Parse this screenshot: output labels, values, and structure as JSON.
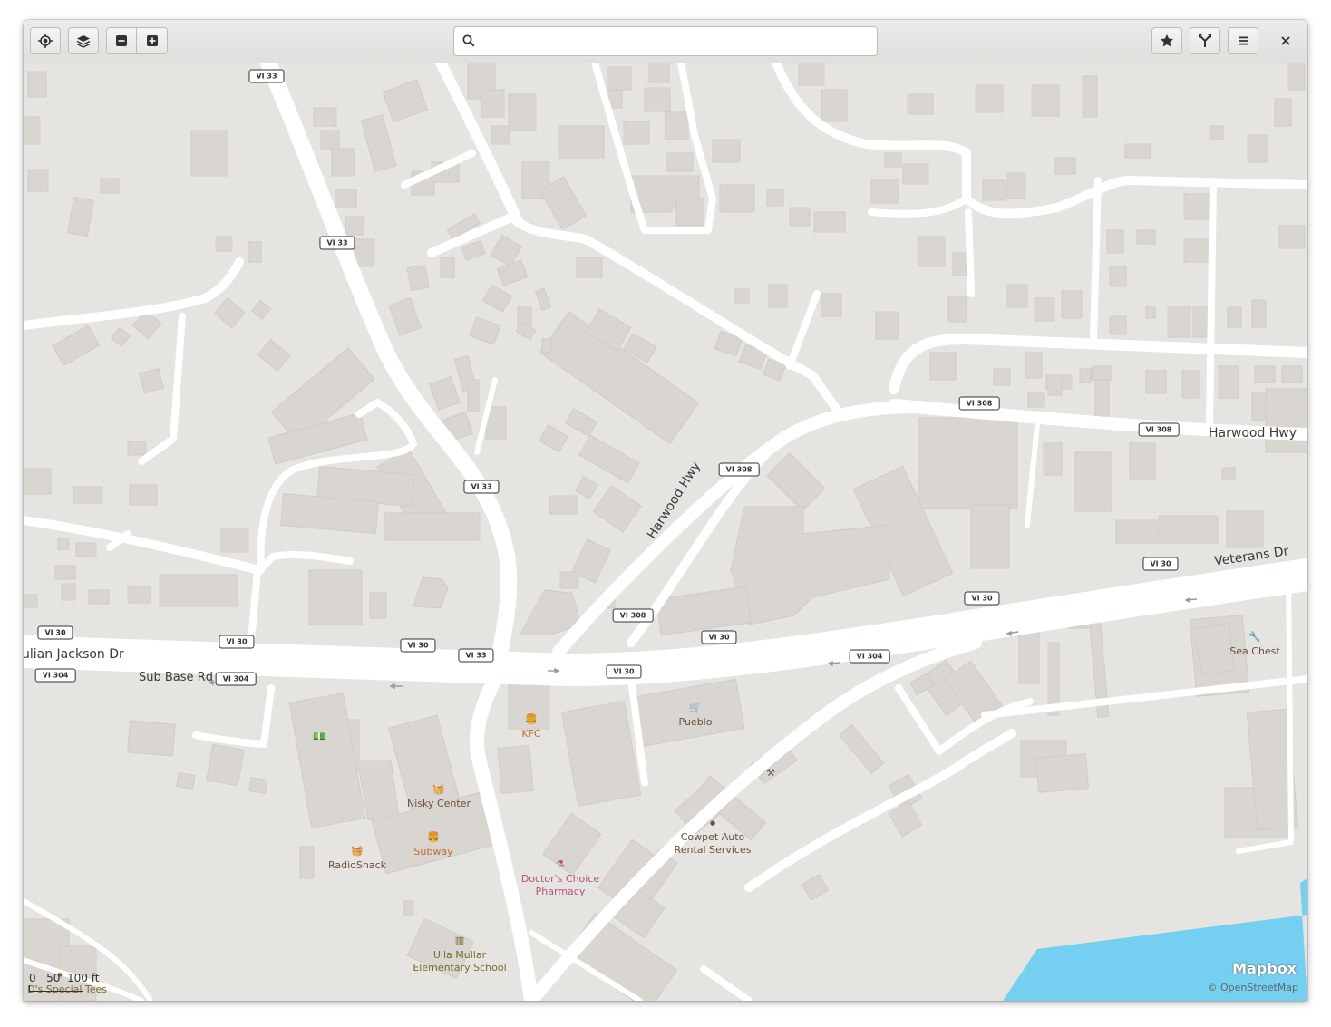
{
  "header": {
    "search": {
      "value": "",
      "placeholder": ""
    },
    "icons": {
      "locate": "crosshair-icon",
      "layers": "layers-icon",
      "zoom_out": "minus-icon",
      "zoom_in": "plus-icon",
      "favorites": "star-icon",
      "route": "route-icon",
      "menu": "hamburger-icon",
      "close": "close-icon"
    }
  },
  "map": {
    "shields": [
      "VI 33",
      "VI 33",
      "VI 33",
      "VI 33",
      "VI 308",
      "VI 308",
      "VI 308",
      "VI 308",
      "VI 30",
      "VI 30",
      "VI 30",
      "VI 30",
      "VI 30",
      "VI 30",
      "VI 30",
      "VI 304",
      "VI 304",
      "VI 304"
    ],
    "road_names": {
      "julian": "ulian Jackson Dr",
      "subbase": "Sub Base Rd",
      "harwood_hwy_diag": "Harwood Hwy",
      "harwood_hwy": "Harwood Hwy",
      "veterans": "Veterans Dr"
    },
    "pois": {
      "kfc": "KFC",
      "pueblo": "Pueblo",
      "nisky": "Nisky Center",
      "subway": "Subway",
      "radioshack": "RadioShack",
      "doctors_line1": "Doctor's Choice",
      "doctors_line2": "Pharmacy",
      "cowpet_line1": "Cowpet Auto",
      "cowpet_line2": "Rental Services",
      "ulla_line1": "Ulla Mullar",
      "ulla_line2": "Elementary School",
      "seachest": "Sea Chest",
      "tees": "lly D's Special Tees"
    },
    "scale": {
      "labels": "0   50  100 ft"
    },
    "brand": "Mapbox",
    "attribution": "© OpenStreetMap",
    "colors": {
      "land": "#e6e4e0",
      "building": "#d9d6d2",
      "road": "#ffffff",
      "water": "#75cff0"
    }
  }
}
